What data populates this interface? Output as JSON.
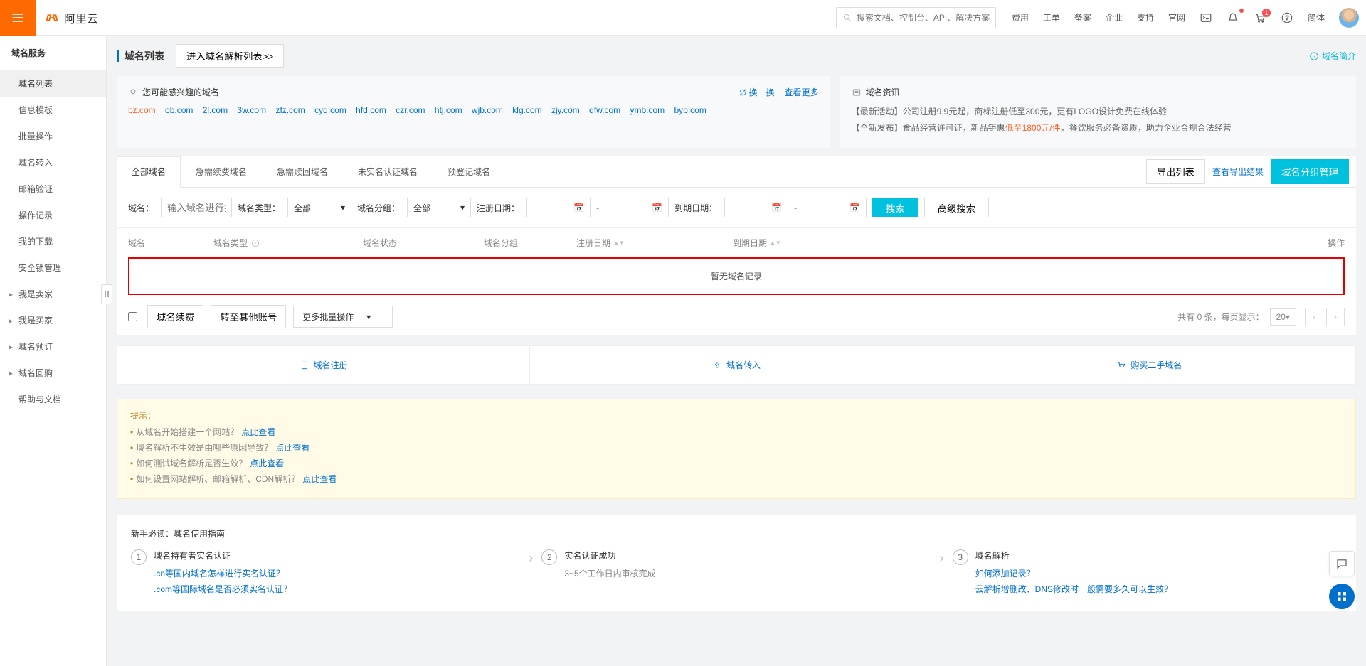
{
  "top": {
    "brand": "阿里云",
    "searchPlaceholder": "搜索文档、控制台、API、解决方案和资源",
    "links": [
      "费用",
      "工单",
      "备案",
      "企业",
      "支持",
      "官网"
    ],
    "lang": "简体",
    "cartBadge": "1"
  },
  "sidebar": {
    "title": "域名服务",
    "plain": [
      "域名列表",
      "信息模板",
      "批量操作",
      "域名转入",
      "邮箱验证",
      "操作记录",
      "我的下载",
      "安全锁管理"
    ],
    "arrow": [
      "我是卖家",
      "我是买家",
      "域名预订",
      "域名回购"
    ],
    "help": "帮助与文档"
  },
  "header": {
    "title": "域名列表",
    "subBtn": "进入域名解析列表>>",
    "intro": "域名简介"
  },
  "panelA": {
    "title": "您可能感兴趣的域名",
    "refresh": "换一换",
    "more": "查看更多",
    "domains": [
      "bz.com",
      "ob.com",
      "2l.com",
      "3w.com",
      "zfz.com",
      "cyq.com",
      "hfd.com",
      "czr.com",
      "htj.com",
      "wjb.com",
      "klg.com",
      "zjy.com",
      "qfw.com",
      "ymb.com",
      "byb.com"
    ]
  },
  "panelB": {
    "title": "域名资讯",
    "l1a": "【最新活动】公司注册9.9元起，商标注册低至300元，更有LOGO设计免费在线体验",
    "l2a": "【全新发布】食品经营许可证，新品钜惠",
    "l2price": "低至1800元/件",
    "l2b": "，餐饮服务必备资质，助力企业合规合法经营"
  },
  "tabs": {
    "items": [
      "全部域名",
      "急需续费域名",
      "急需赎回域名",
      "未实名认证域名",
      "预登记域名"
    ],
    "export": "导出列表",
    "view": "查看导出结果",
    "manage": "域名分组管理"
  },
  "filter": {
    "domainLbl": "域名：",
    "domainPh": "输入域名进行搜索",
    "typeLbl": "域名类型：",
    "typeVal": "全部",
    "groupLbl": "域名分组：",
    "groupVal": "全部",
    "regLbl": "注册日期：",
    "expLbl": "到期日期：",
    "dash": "-",
    "search": "搜索",
    "adv": "高级搜索"
  },
  "tableHead": {
    "d": "域名",
    "ty": "域名类型",
    "st": "域名状态",
    "gp": "域名分组",
    "rd": "注册日期",
    "ed": "到期日期",
    "op": "操作"
  },
  "empty": "暂无域名记录",
  "bulk": {
    "renew": "域名续费",
    "transfer": "转至其他账号",
    "more": "更多批量操作",
    "totalA": "共有 0 条，每页显示：",
    "pageSize": "20"
  },
  "cards": {
    "reg": "域名注册",
    "in": "域名转入",
    "buy": "购买二手域名"
  },
  "hint": {
    "title": "提示：",
    "look": "点此查看",
    "q1": "从域名开始搭建一个网站？",
    "q2": "域名解析不生效是由哪些原因导致？",
    "q3": "如何测试域名解析是否生效？",
    "q4": "如何设置网站解析、邮箱解析、CDN解析？"
  },
  "guide": {
    "title": "新手必读：域名使用指南",
    "s1": {
      "t": "域名持有者实名认证",
      "l1": ".cn等国内域名怎样进行实名认证？",
      "l2": ".com等国际域名是否必须实名认证？"
    },
    "s2": {
      "t": "实名认证成功",
      "sub": "3~5个工作日内审核完成"
    },
    "s3": {
      "t": "域名解析",
      "l1": "如何添加记录？",
      "l2": "云解析增删改、DNS修改时一般需要多久可以生效？"
    }
  }
}
